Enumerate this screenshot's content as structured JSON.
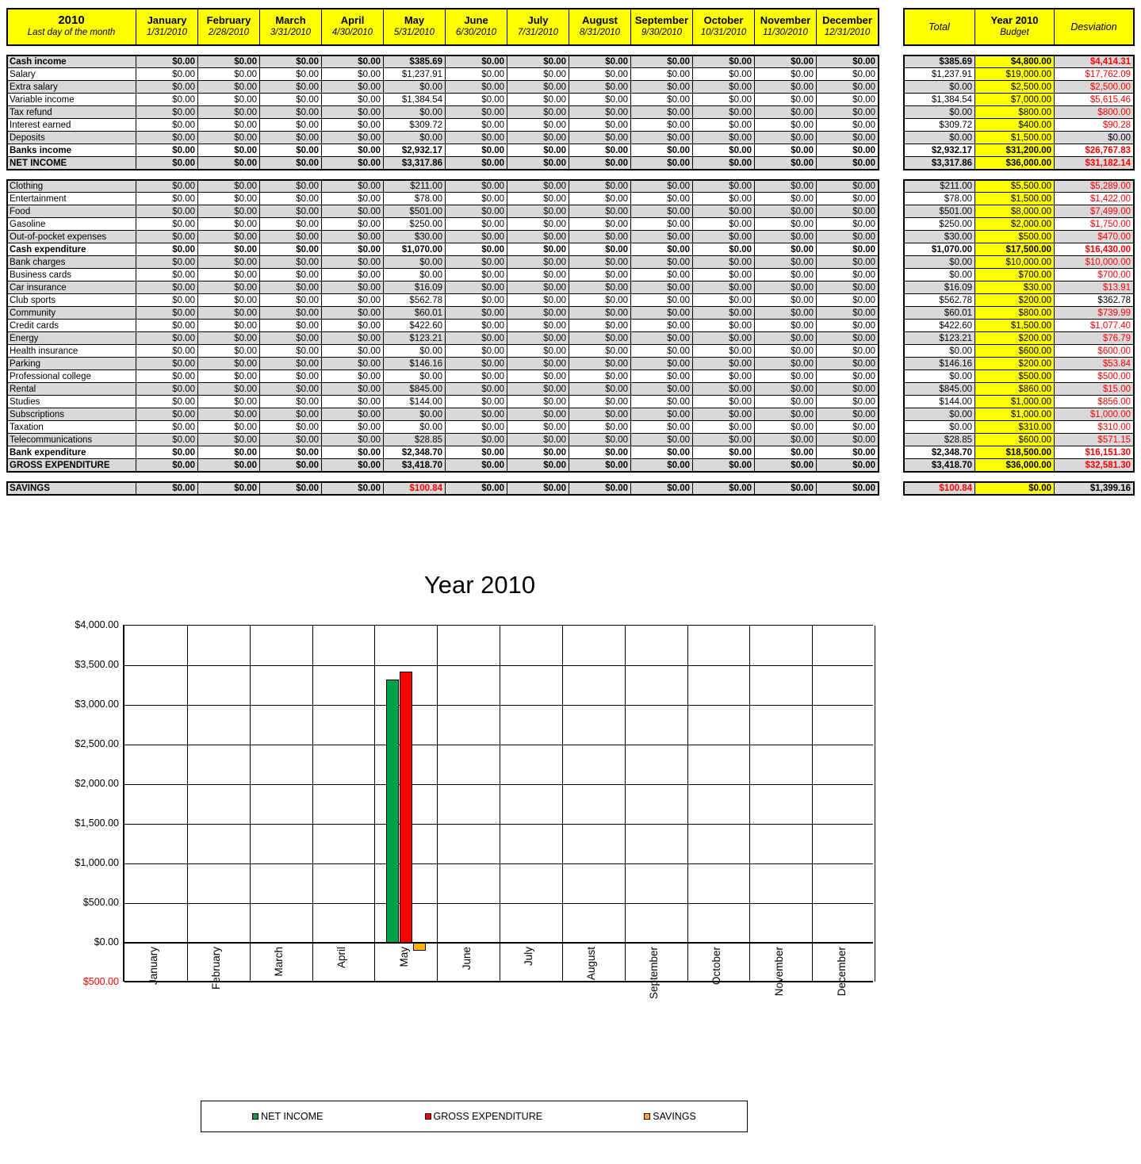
{
  "header": {
    "year_label": "2010",
    "year_sub": "Last day of the month",
    "months": [
      {
        "name": "January",
        "date": "1/31/2010"
      },
      {
        "name": "February",
        "date": "2/28/2010"
      },
      {
        "name": "March",
        "date": "3/31/2010"
      },
      {
        "name": "April",
        "date": "4/30/2010"
      },
      {
        "name": "May",
        "date": "5/31/2010"
      },
      {
        "name": "June",
        "date": "6/30/2010"
      },
      {
        "name": "July",
        "date": "7/31/2010"
      },
      {
        "name": "August",
        "date": "8/31/2010"
      },
      {
        "name": "September",
        "date": "9/30/2010"
      },
      {
        "name": "October",
        "date": "10/31/2010"
      },
      {
        "name": "November",
        "date": "11/30/2010"
      },
      {
        "name": "December",
        "date": "12/31/2010"
      }
    ],
    "total_label": "Total",
    "budget_label_1": "Year 2010",
    "budget_label_2": "Budget",
    "deviation_label": "Desviation"
  },
  "colors": {
    "header_yellow": "#FFFF00",
    "band_gray": "#D9D9D9",
    "negative_red": "#FF0000",
    "net_income_green": "#00A14B",
    "gross_expenditure_red": "#FF0000",
    "savings_orange": "#FFB400"
  },
  "income_rows": [
    {
      "label": "Cash income",
      "bold": true,
      "shade": true,
      "months": [
        "$0.00",
        "$0.00",
        "$0.00",
        "$0.00",
        "$385.69",
        "$0.00",
        "$0.00",
        "$0.00",
        "$0.00",
        "$0.00",
        "$0.00",
        "$0.00"
      ],
      "total": "$385.69",
      "budget": "$4,800.00",
      "deviation": "$4,414.31",
      "dev_neg": true
    },
    {
      "label": "Salary",
      "bold": false,
      "shade": false,
      "months": [
        "$0.00",
        "$0.00",
        "$0.00",
        "$0.00",
        "$1,237.91",
        "$0.00",
        "$0.00",
        "$0.00",
        "$0.00",
        "$0.00",
        "$0.00",
        "$0.00"
      ],
      "total": "$1,237.91",
      "budget": "$19,000.00",
      "deviation": "$17,762.09",
      "dev_neg": true
    },
    {
      "label": "Extra salary",
      "bold": false,
      "shade": true,
      "months": [
        "$0.00",
        "$0.00",
        "$0.00",
        "$0.00",
        "$0.00",
        "$0.00",
        "$0.00",
        "$0.00",
        "$0.00",
        "$0.00",
        "$0.00",
        "$0.00"
      ],
      "total": "$0.00",
      "budget": "$2,500.00",
      "deviation": "$2,500.00",
      "dev_neg": true
    },
    {
      "label": "Variable income",
      "bold": false,
      "shade": false,
      "months": [
        "$0.00",
        "$0.00",
        "$0.00",
        "$0.00",
        "$1,384.54",
        "$0.00",
        "$0.00",
        "$0.00",
        "$0.00",
        "$0.00",
        "$0.00",
        "$0.00"
      ],
      "total": "$1,384.54",
      "budget": "$7,000.00",
      "deviation": "$5,615.46",
      "dev_neg": true
    },
    {
      "label": "Tax refund",
      "bold": false,
      "shade": true,
      "months": [
        "$0.00",
        "$0.00",
        "$0.00",
        "$0.00",
        "$0.00",
        "$0.00",
        "$0.00",
        "$0.00",
        "$0.00",
        "$0.00",
        "$0.00",
        "$0.00"
      ],
      "total": "$0.00",
      "budget": "$800.00",
      "deviation": "$800.00",
      "dev_neg": true
    },
    {
      "label": "Interest earned",
      "bold": false,
      "shade": false,
      "months": [
        "$0.00",
        "$0.00",
        "$0.00",
        "$0.00",
        "$309.72",
        "$0.00",
        "$0.00",
        "$0.00",
        "$0.00",
        "$0.00",
        "$0.00",
        "$0.00"
      ],
      "total": "$309.72",
      "budget": "$400.00",
      "deviation": "$90.28",
      "dev_neg": true
    },
    {
      "label": "Deposits",
      "bold": false,
      "shade": true,
      "months": [
        "$0.00",
        "$0.00",
        "$0.00",
        "$0.00",
        "$0.00",
        "$0.00",
        "$0.00",
        "$0.00",
        "$0.00",
        "$0.00",
        "$0.00",
        "$0.00"
      ],
      "total": "$0.00",
      "budget": "$1,500.00",
      "deviation": "$0.00",
      "dev_neg": false
    },
    {
      "label": "Banks income",
      "bold": true,
      "shade": false,
      "months": [
        "$0.00",
        "$0.00",
        "$0.00",
        "$0.00",
        "$2,932.17",
        "$0.00",
        "$0.00",
        "$0.00",
        "$0.00",
        "$0.00",
        "$0.00",
        "$0.00"
      ],
      "total": "$2,932.17",
      "budget": "$31,200.00",
      "deviation": "$26,767.83",
      "dev_neg": true
    },
    {
      "label": "NET INCOME",
      "bold": true,
      "shade": true,
      "months": [
        "$0.00",
        "$0.00",
        "$0.00",
        "$0.00",
        "$3,317.86",
        "$0.00",
        "$0.00",
        "$0.00",
        "$0.00",
        "$0.00",
        "$0.00",
        "$0.00"
      ],
      "total": "$3,317.86",
      "budget": "$36,000.00",
      "deviation": "$31,182.14",
      "dev_neg": true
    }
  ],
  "expense_rows": [
    {
      "label": "Clothing",
      "bold": false,
      "shade": true,
      "months": [
        "$0.00",
        "$0.00",
        "$0.00",
        "$0.00",
        "$211.00",
        "$0.00",
        "$0.00",
        "$0.00",
        "$0.00",
        "$0.00",
        "$0.00",
        "$0.00"
      ],
      "total": "$211.00",
      "budget": "$5,500.00",
      "deviation": "$5,289.00",
      "dev_neg": true
    },
    {
      "label": "Entertainment",
      "bold": false,
      "shade": false,
      "months": [
        "$0.00",
        "$0.00",
        "$0.00",
        "$0.00",
        "$78.00",
        "$0.00",
        "$0.00",
        "$0.00",
        "$0.00",
        "$0.00",
        "$0.00",
        "$0.00"
      ],
      "total": "$78.00",
      "budget": "$1,500.00",
      "deviation": "$1,422.00",
      "dev_neg": true
    },
    {
      "label": "Food",
      "bold": false,
      "shade": true,
      "months": [
        "$0.00",
        "$0.00",
        "$0.00",
        "$0.00",
        "$501.00",
        "$0.00",
        "$0.00",
        "$0.00",
        "$0.00",
        "$0.00",
        "$0.00",
        "$0.00"
      ],
      "total": "$501.00",
      "budget": "$8,000.00",
      "deviation": "$7,499.00",
      "dev_neg": true
    },
    {
      "label": "Gasoline",
      "bold": false,
      "shade": false,
      "months": [
        "$0.00",
        "$0.00",
        "$0.00",
        "$0.00",
        "$250.00",
        "$0.00",
        "$0.00",
        "$0.00",
        "$0.00",
        "$0.00",
        "$0.00",
        "$0.00"
      ],
      "total": "$250.00",
      "budget": "$2,000.00",
      "deviation": "$1,750.00",
      "dev_neg": true
    },
    {
      "label": "Out-of-pocket expenses",
      "bold": false,
      "shade": true,
      "months": [
        "$0.00",
        "$0.00",
        "$0.00",
        "$0.00",
        "$30.00",
        "$0.00",
        "$0.00",
        "$0.00",
        "$0.00",
        "$0.00",
        "$0.00",
        "$0.00"
      ],
      "total": "$30.00",
      "budget": "$500.00",
      "deviation": "$470.00",
      "dev_neg": true
    },
    {
      "label": "Cash expenditure",
      "bold": true,
      "shade": false,
      "months": [
        "$0.00",
        "$0.00",
        "$0.00",
        "$0.00",
        "$1,070.00",
        "$0.00",
        "$0.00",
        "$0.00",
        "$0.00",
        "$0.00",
        "$0.00",
        "$0.00"
      ],
      "total": "$1,070.00",
      "budget": "$17,500.00",
      "deviation": "$16,430.00",
      "dev_neg": true
    },
    {
      "label": "Bank charges",
      "bold": false,
      "shade": true,
      "months": [
        "$0.00",
        "$0.00",
        "$0.00",
        "$0.00",
        "$0.00",
        "$0.00",
        "$0.00",
        "$0.00",
        "$0.00",
        "$0.00",
        "$0.00",
        "$0.00"
      ],
      "total": "$0.00",
      "budget": "$10,000.00",
      "deviation": "$10,000.00",
      "dev_neg": true
    },
    {
      "label": "Business cards",
      "bold": false,
      "shade": false,
      "months": [
        "$0.00",
        "$0.00",
        "$0.00",
        "$0.00",
        "$0.00",
        "$0.00",
        "$0.00",
        "$0.00",
        "$0.00",
        "$0.00",
        "$0.00",
        "$0.00"
      ],
      "total": "$0.00",
      "budget": "$700.00",
      "deviation": "$700.00",
      "dev_neg": true
    },
    {
      "label": "Car insurance",
      "bold": false,
      "shade": true,
      "months": [
        "$0.00",
        "$0.00",
        "$0.00",
        "$0.00",
        "$16.09",
        "$0.00",
        "$0.00",
        "$0.00",
        "$0.00",
        "$0.00",
        "$0.00",
        "$0.00"
      ],
      "total": "$16.09",
      "budget": "$30.00",
      "deviation": "$13.91",
      "dev_neg": true
    },
    {
      "label": "Club sports",
      "bold": false,
      "shade": false,
      "months": [
        "$0.00",
        "$0.00",
        "$0.00",
        "$0.00",
        "$562.78",
        "$0.00",
        "$0.00",
        "$0.00",
        "$0.00",
        "$0.00",
        "$0.00",
        "$0.00"
      ],
      "total": "$562.78",
      "budget": "$200.00",
      "deviation": "$362.78",
      "dev_neg": false
    },
    {
      "label": "Community",
      "bold": false,
      "shade": true,
      "months": [
        "$0.00",
        "$0.00",
        "$0.00",
        "$0.00",
        "$60.01",
        "$0.00",
        "$0.00",
        "$0.00",
        "$0.00",
        "$0.00",
        "$0.00",
        "$0.00"
      ],
      "total": "$60.01",
      "budget": "$800.00",
      "deviation": "$739.99",
      "dev_neg": true
    },
    {
      "label": "Credit cards",
      "bold": false,
      "shade": false,
      "months": [
        "$0.00",
        "$0.00",
        "$0.00",
        "$0.00",
        "$422.60",
        "$0.00",
        "$0.00",
        "$0.00",
        "$0.00",
        "$0.00",
        "$0.00",
        "$0.00"
      ],
      "total": "$422.60",
      "budget": "$1,500.00",
      "deviation": "$1,077.40",
      "dev_neg": true
    },
    {
      "label": "Energy",
      "bold": false,
      "shade": true,
      "months": [
        "$0.00",
        "$0.00",
        "$0.00",
        "$0.00",
        "$123.21",
        "$0.00",
        "$0.00",
        "$0.00",
        "$0.00",
        "$0.00",
        "$0.00",
        "$0.00"
      ],
      "total": "$123.21",
      "budget": "$200.00",
      "deviation": "$76.79",
      "dev_neg": true
    },
    {
      "label": "Health insurance",
      "bold": false,
      "shade": false,
      "months": [
        "$0.00",
        "$0.00",
        "$0.00",
        "$0.00",
        "$0.00",
        "$0.00",
        "$0.00",
        "$0.00",
        "$0.00",
        "$0.00",
        "$0.00",
        "$0.00"
      ],
      "total": "$0.00",
      "budget": "$600.00",
      "deviation": "$600.00",
      "dev_neg": true
    },
    {
      "label": "Parking",
      "bold": false,
      "shade": true,
      "months": [
        "$0.00",
        "$0.00",
        "$0.00",
        "$0.00",
        "$146.16",
        "$0.00",
        "$0.00",
        "$0.00",
        "$0.00",
        "$0.00",
        "$0.00",
        "$0.00"
      ],
      "total": "$146.16",
      "budget": "$200.00",
      "deviation": "$53.84",
      "dev_neg": true
    },
    {
      "label": "Professional college",
      "bold": false,
      "shade": false,
      "months": [
        "$0.00",
        "$0.00",
        "$0.00",
        "$0.00",
        "$0.00",
        "$0.00",
        "$0.00",
        "$0.00",
        "$0.00",
        "$0.00",
        "$0.00",
        "$0.00"
      ],
      "total": "$0.00",
      "budget": "$500.00",
      "deviation": "$500.00",
      "dev_neg": true
    },
    {
      "label": "Rental",
      "bold": false,
      "shade": true,
      "months": [
        "$0.00",
        "$0.00",
        "$0.00",
        "$0.00",
        "$845.00",
        "$0.00",
        "$0.00",
        "$0.00",
        "$0.00",
        "$0.00",
        "$0.00",
        "$0.00"
      ],
      "total": "$845.00",
      "budget": "$860.00",
      "deviation": "$15.00",
      "dev_neg": true
    },
    {
      "label": "Studies",
      "bold": false,
      "shade": false,
      "months": [
        "$0.00",
        "$0.00",
        "$0.00",
        "$0.00",
        "$144.00",
        "$0.00",
        "$0.00",
        "$0.00",
        "$0.00",
        "$0.00",
        "$0.00",
        "$0.00"
      ],
      "total": "$144.00",
      "budget": "$1,000.00",
      "deviation": "$856.00",
      "dev_neg": true
    },
    {
      "label": "Subscriptions",
      "bold": false,
      "shade": true,
      "months": [
        "$0.00",
        "$0.00",
        "$0.00",
        "$0.00",
        "$0.00",
        "$0.00",
        "$0.00",
        "$0.00",
        "$0.00",
        "$0.00",
        "$0.00",
        "$0.00"
      ],
      "total": "$0.00",
      "budget": "$1,000.00",
      "deviation": "$1,000.00",
      "dev_neg": true
    },
    {
      "label": "Taxation",
      "bold": false,
      "shade": false,
      "months": [
        "$0.00",
        "$0.00",
        "$0.00",
        "$0.00",
        "$0.00",
        "$0.00",
        "$0.00",
        "$0.00",
        "$0.00",
        "$0.00",
        "$0.00",
        "$0.00"
      ],
      "total": "$0.00",
      "budget": "$310.00",
      "deviation": "$310.00",
      "dev_neg": true
    },
    {
      "label": "Telecommunications",
      "bold": false,
      "shade": true,
      "months": [
        "$0.00",
        "$0.00",
        "$0.00",
        "$0.00",
        "$28.85",
        "$0.00",
        "$0.00",
        "$0.00",
        "$0.00",
        "$0.00",
        "$0.00",
        "$0.00"
      ],
      "total": "$28.85",
      "budget": "$600.00",
      "deviation": "$571.15",
      "dev_neg": true
    },
    {
      "label": "Bank expenditure",
      "bold": true,
      "shade": false,
      "months": [
        "$0.00",
        "$0.00",
        "$0.00",
        "$0.00",
        "$2,348.70",
        "$0.00",
        "$0.00",
        "$0.00",
        "$0.00",
        "$0.00",
        "$0.00",
        "$0.00"
      ],
      "total": "$2,348.70",
      "budget": "$18,500.00",
      "deviation": "$16,151.30",
      "dev_neg": true
    },
    {
      "label": "GROSS EXPENDITURE",
      "bold": true,
      "shade": true,
      "months": [
        "$0.00",
        "$0.00",
        "$0.00",
        "$0.00",
        "$3,418.70",
        "$0.00",
        "$0.00",
        "$0.00",
        "$0.00",
        "$0.00",
        "$0.00",
        "$0.00"
      ],
      "total": "$3,418.70",
      "budget": "$36,000.00",
      "deviation": "$32,581.30",
      "dev_neg": true
    }
  ],
  "savings_row": {
    "label": "SAVINGS",
    "bold": true,
    "shade": true,
    "months": [
      "$0.00",
      "$0.00",
      "$0.00",
      "$0.00",
      "$100.84",
      "$0.00",
      "$0.00",
      "$0.00",
      "$0.00",
      "$0.00",
      "$0.00",
      "$0.00"
    ],
    "month_neg_index": 4,
    "total": "$100.84",
    "total_neg": true,
    "budget": "$0.00",
    "deviation": "$1,399.16",
    "dev_neg": false
  },
  "chart_data": {
    "type": "bar",
    "title": "Year 2010",
    "xlabel": "",
    "ylabel": "",
    "ylim": [
      -500,
      4000
    ],
    "ytick_labels": [
      "$4,000.00",
      "$3,500.00",
      "$3,000.00",
      "$2,500.00",
      "$2,000.00",
      "$1,500.00",
      "$1,000.00",
      "$500.00",
      "$0.00",
      "$500.00"
    ],
    "ytick_values": [
      4000,
      3500,
      3000,
      2500,
      2000,
      1500,
      1000,
      500,
      0,
      -500
    ],
    "grid": true,
    "legend_position": "bottom",
    "categories": [
      "January",
      "February",
      "March",
      "April",
      "May",
      "June",
      "July",
      "August",
      "September",
      "October",
      "November",
      "December"
    ],
    "series": [
      {
        "name": "NET INCOME",
        "color": "#00A14B",
        "values": [
          0,
          0,
          0,
          0,
          3317.86,
          0,
          0,
          0,
          0,
          0,
          0,
          0
        ]
      },
      {
        "name": "GROSS EXPENDITURE",
        "color": "#FF0000",
        "values": [
          0,
          0,
          0,
          0,
          3418.7,
          0,
          0,
          0,
          0,
          0,
          0,
          0
        ]
      },
      {
        "name": "SAVINGS",
        "color": "#FFB400",
        "values": [
          0,
          0,
          0,
          0,
          -100.84,
          0,
          0,
          0,
          0,
          0,
          0,
          0
        ]
      }
    ]
  }
}
